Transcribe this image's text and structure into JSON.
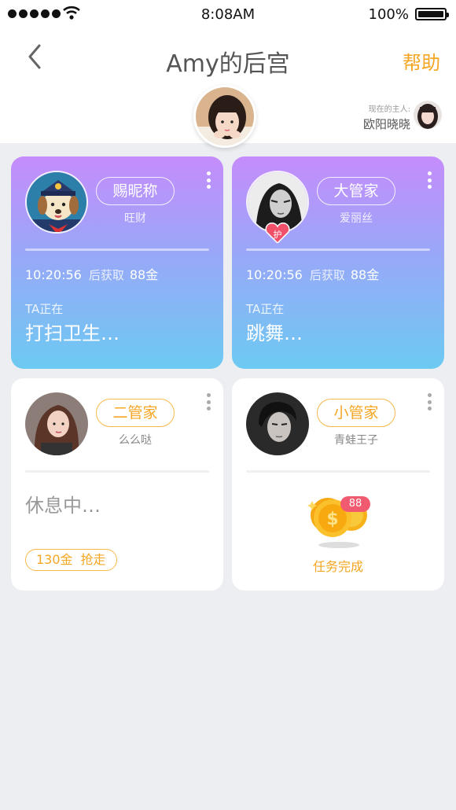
{
  "status_bar": {
    "time": "8:08AM",
    "battery": "100%"
  },
  "header": {
    "title": "Amy的后宫",
    "help": "帮助",
    "owner_label": "现在的主人:",
    "owner_name": "欧阳晓晓"
  },
  "cards": [
    {
      "role": "赐昵称",
      "name": "旺财",
      "time": "10:20:56",
      "after_label": "后获取",
      "gold": "88金",
      "doing_label": "TA正在",
      "doing": "打扫卫生…"
    },
    {
      "role": "大管家",
      "name": "爱丽丝",
      "time": "10:20:56",
      "after_label": "后获取",
      "gold": "88金",
      "doing_label": "TA正在",
      "doing": "跳舞…",
      "badge": "护"
    },
    {
      "role": "二管家",
      "name": "么么哒",
      "status": "休息中…",
      "grab_price": "130金",
      "grab_label": "抢走"
    },
    {
      "role": "小管家",
      "name": "青蛙王子",
      "coin_badge": "88",
      "complete": "任务完成"
    }
  ],
  "colors": {
    "accent": "#f5a623",
    "gradient_top": "#c58cfb",
    "gradient_bottom": "#6ccaf2",
    "badge": "#f25b6f"
  }
}
